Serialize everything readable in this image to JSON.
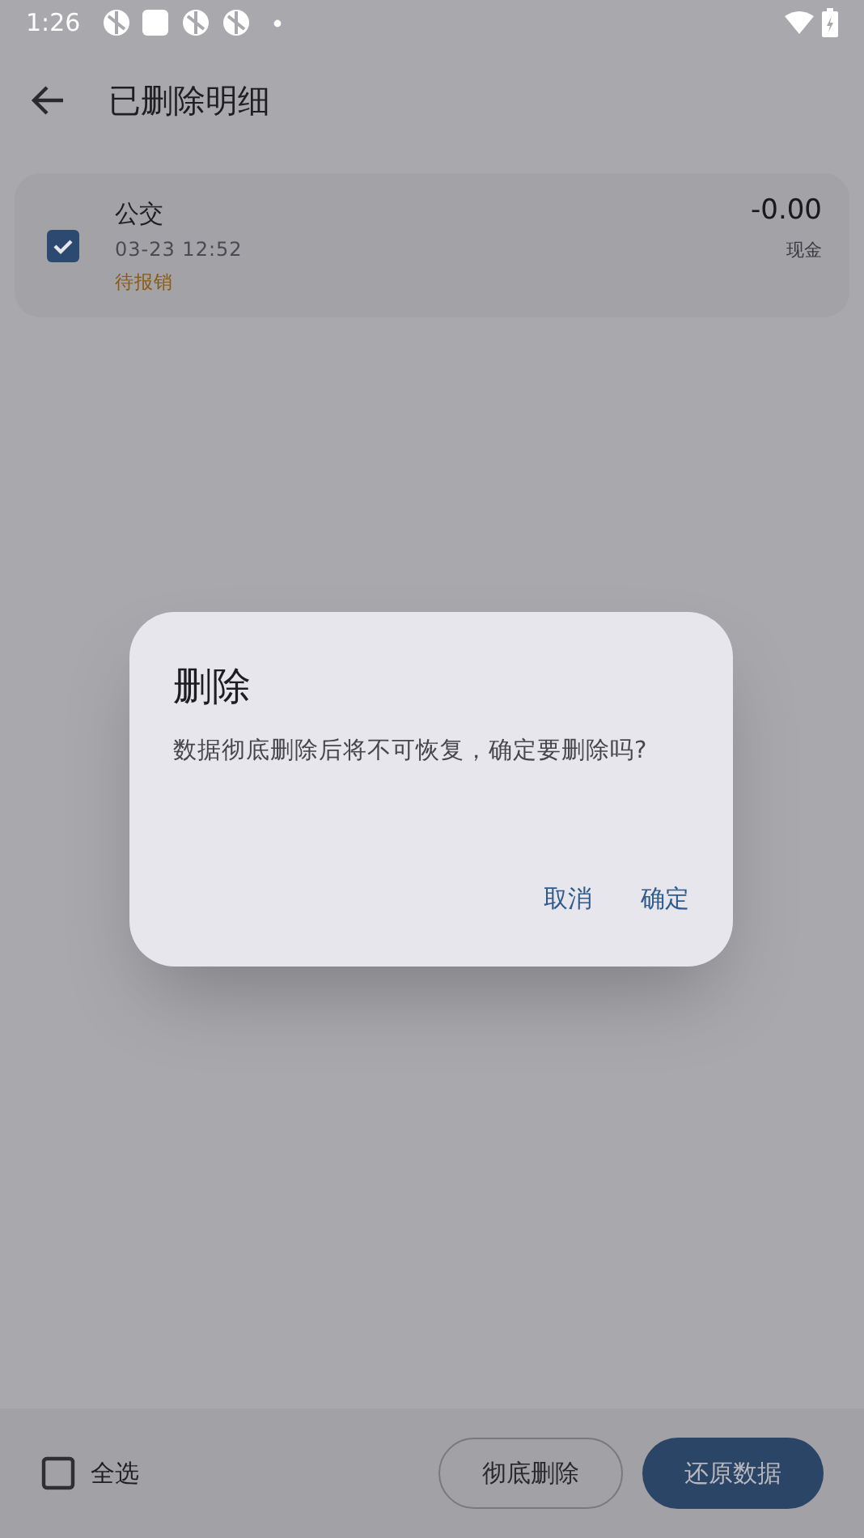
{
  "status_bar": {
    "time": "1:26"
  },
  "app_bar": {
    "title": "已删除明细"
  },
  "records": [
    {
      "name": "公交",
      "time": "03-23 12:52",
      "tag": "待报销",
      "amount": "-0.00",
      "account": "现金",
      "checked": true
    }
  ],
  "dialog": {
    "title": "删除",
    "message": "数据彻底删除后将不可恢复，确定要删除吗?",
    "buttons": [
      "取消",
      "确定"
    ]
  },
  "bottom_bar": {
    "select_all": {
      "label": "全选",
      "checked": false
    },
    "buttons": [
      {
        "label": "彻底删除",
        "kind": "outlined"
      },
      {
        "label": "还原数据",
        "kind": "filled"
      }
    ]
  }
}
